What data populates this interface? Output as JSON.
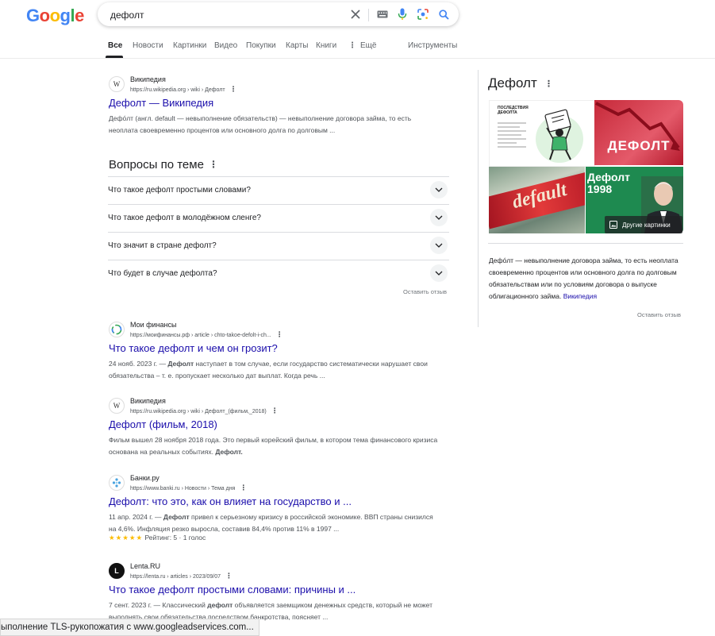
{
  "header": {
    "logo_letters": [
      {
        "ch": "G",
        "color": "#4285F4"
      },
      {
        "ch": "o",
        "color": "#EA4335"
      },
      {
        "ch": "o",
        "color": "#FBBC05"
      },
      {
        "ch": "g",
        "color": "#4285F4"
      },
      {
        "ch": "l",
        "color": "#34A853"
      },
      {
        "ch": "e",
        "color": "#EA4335"
      }
    ],
    "search_value": "дефолт"
  },
  "tabs": {
    "all": "Все",
    "news": "Новости",
    "images": "Картинки",
    "video": "Видео",
    "shopping": "Покупки",
    "maps": "Карты",
    "books": "Книги",
    "more": "Ещё",
    "tools": "Инструменты"
  },
  "results": [
    {
      "site": "Википедия",
      "url": "https://ru.wikipedia.org › wiki › Дефолт",
      "title": "Дефолт — Википедия",
      "snippet": "Дефо́лт (англ. default — невыполнение обязательств) — невыполнение договора займа, то есть неоплата своевременно процентов или основного долга по долговым ..."
    },
    {
      "site": "Мои финансы",
      "url": "https://моифинансы.рф › article › chto-takoe-defolt-i-ch...",
      "title": "Что такое дефолт и чем он грозит?",
      "date": "24 нояб. 2023 г. —",
      "snippet_bold": "Дефолт",
      "snippet": "наступает в том случае, если государство систематически нарушает свои обязательства – т. е. пропускает несколько дат выплат. Когда речь ..."
    },
    {
      "site": "Википедия",
      "url": "https://ru.wikipedia.org › wiki › Дефолт_(фильм,_2018)",
      "title": "Дефолт (фильм, 2018)",
      "snippet": "Фильм вышел 28 ноября 2018 года. Это первый корейский фильм, в котором тема финансового кризиса основана на реальных событиях.",
      "snippet_end_bold": "Дефолт."
    },
    {
      "site": "Банки.ру",
      "url": "https://www.banki.ru › Новости › Тема дня",
      "title": "Дефолт: что это, как он влияет на государство и ...",
      "date": "11 апр. 2024 г. —",
      "snippet_bold": "Дефолт",
      "snippet": "привел к серьезному кризису в российской экономике. ВВП страны снизился на 4,6%. Инфляция резко выросла, составив 84,4% против 11% в 1997 ...",
      "stars": "★★★★★",
      "rating": "Рейтинг: 5 · 1 голос"
    },
    {
      "site": "Lenta.RU",
      "url": "https://lenta.ru › articles › 2023/09/07",
      "title": "Что такое дефолт простыми словами: причины и ...",
      "date": "7 сент. 2023 г. —",
      "snippet_lead": "Классический",
      "snippet_bold": "дефолт",
      "snippet": "объявляется заемщиком денежных средств, который не может выполнять свои обязательства посредством банкротства, поясняет ..."
    }
  ],
  "paa": {
    "title": "Вопросы по теме",
    "questions": [
      "Что такое дефолт простыми словами?",
      "Что такое дефолт в молодёжном сленге?",
      "Что значит в стране дефолт?",
      "Что будет в случае дефолта?"
    ],
    "feedback": "Оставить отзыв"
  },
  "knowledge_panel": {
    "title": "Дефолт",
    "img1_caption_lines": [
      "последствия",
      "дефолта"
    ],
    "img2_text": "ДЕФОЛТ",
    "img3_text": "default",
    "img4_text_lines": [
      "Дефолт",
      "1998"
    ],
    "more_images": "Другие картинки",
    "description": "Дефо́лт — невыполнение договора займа, то есть неоплата своевременно процентов или основного долга по долговым обязательствам или по условиям договора о выпуске облигационного займа.",
    "source_link": "Википедия",
    "feedback": "Оставить отзыв"
  },
  "status_bar": "ыполнение TLS-рукопожатия с www.googleadservices.com..."
}
